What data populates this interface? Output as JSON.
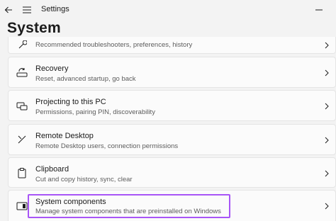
{
  "window": {
    "app_title": "Settings"
  },
  "page": {
    "title": "System"
  },
  "items": [
    {
      "label": "",
      "description": "Recommended troubleshooters, preferences, history",
      "icon": "troubleshoot-icon"
    },
    {
      "label": "Recovery",
      "description": "Reset, advanced startup, go back",
      "icon": "recovery-icon"
    },
    {
      "label": "Projecting to this PC",
      "description": "Permissions, pairing PIN, discoverability",
      "icon": "projecting-icon"
    },
    {
      "label": "Remote Desktop",
      "description": "Remote Desktop users, connection permissions",
      "icon": "remote-desktop-icon"
    },
    {
      "label": "Clipboard",
      "description": "Cut and copy history, sync, clear",
      "icon": "clipboard-icon"
    },
    {
      "label": "System components",
      "description": "Manage system components that are preinstalled on Windows",
      "icon": "system-components-icon"
    }
  ],
  "colors": {
    "background": "#f3f3f3",
    "card": "#fbfbfb",
    "highlight": "#a855f7"
  }
}
